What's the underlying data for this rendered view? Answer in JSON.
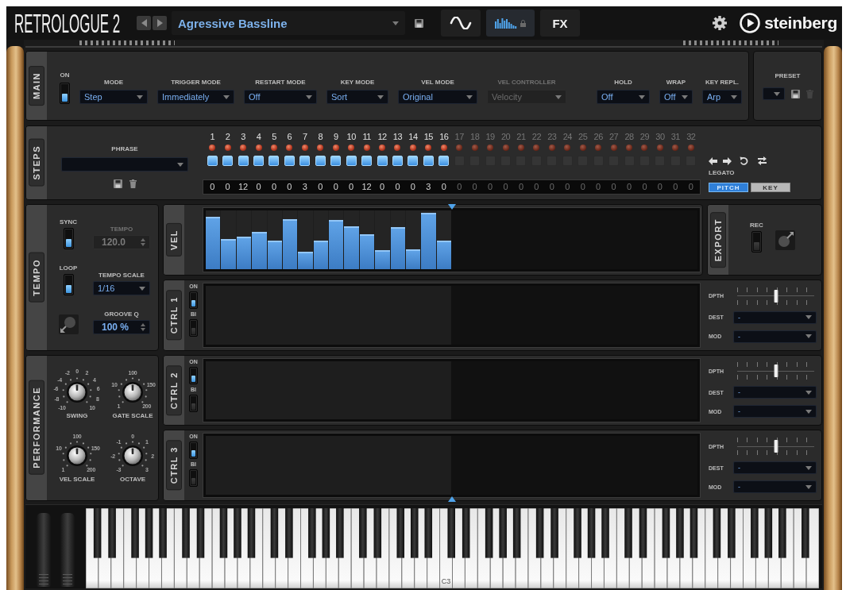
{
  "header": {
    "product": "RETROLOGUE 2",
    "preset_name": "Agressive Bassline",
    "pages": [
      {
        "kind": "wave",
        "selected": false
      },
      {
        "kind": "sequencer",
        "selected": true
      },
      {
        "kind": "label",
        "label": "FX",
        "selected": false
      }
    ],
    "brand": "steinberg"
  },
  "main": {
    "tab": "MAIN",
    "on_label": "ON",
    "on": true,
    "dropdowns": [
      {
        "label": "MODE",
        "value": "Step",
        "disabled": false
      },
      {
        "label": "TRIGGER MODE",
        "value": "Immediately",
        "disabled": false
      },
      {
        "label": "RESTART MODE",
        "value": "Off",
        "disabled": false
      },
      {
        "label": "KEY MODE",
        "value": "Sort",
        "disabled": false
      },
      {
        "label": "VEL MODE",
        "value": "Original",
        "disabled": false
      },
      {
        "label": "VEL CONTROLLER",
        "value": "Velocity",
        "disabled": true
      },
      {
        "label": "HOLD",
        "value": "Off",
        "disabled": false
      },
      {
        "label": "WRAP",
        "value": "Off",
        "disabled": false
      },
      {
        "label": "KEY REPL.",
        "value": "Arp",
        "disabled": false
      }
    ]
  },
  "preset": {
    "label": "PRESET",
    "actions": [
      {
        "kind": "save",
        "disabled": false
      },
      {
        "kind": "delete",
        "disabled": true
      }
    ]
  },
  "steps": {
    "tab": "STEPS",
    "phrase_label": "PHRASE",
    "items": [
      {
        "number": "1",
        "value": "0",
        "enabled": true
      },
      {
        "number": "2",
        "value": "0",
        "enabled": true
      },
      {
        "number": "3",
        "value": "12",
        "enabled": true
      },
      {
        "number": "4",
        "value": "0",
        "enabled": true
      },
      {
        "number": "5",
        "value": "0",
        "enabled": true
      },
      {
        "number": "6",
        "value": "0",
        "enabled": true
      },
      {
        "number": "7",
        "value": "3",
        "enabled": true
      },
      {
        "number": "8",
        "value": "0",
        "enabled": true
      },
      {
        "number": "9",
        "value": "0",
        "enabled": true
      },
      {
        "number": "10",
        "value": "0",
        "enabled": true
      },
      {
        "number": "11",
        "value": "12",
        "enabled": true
      },
      {
        "number": "12",
        "value": "0",
        "enabled": true
      },
      {
        "number": "13",
        "value": "0",
        "enabled": true
      },
      {
        "number": "14",
        "value": "0",
        "enabled": true
      },
      {
        "number": "15",
        "value": "3",
        "enabled": true
      },
      {
        "number": "16",
        "value": "0",
        "enabled": true
      },
      {
        "number": "17",
        "value": "0",
        "enabled": false
      },
      {
        "number": "18",
        "value": "0",
        "enabled": false
      },
      {
        "number": "19",
        "value": "0",
        "enabled": false
      },
      {
        "number": "20",
        "value": "0",
        "enabled": false
      },
      {
        "number": "21",
        "value": "0",
        "enabled": false
      },
      {
        "number": "22",
        "value": "0",
        "enabled": false
      },
      {
        "number": "23",
        "value": "0",
        "enabled": false
      },
      {
        "number": "24",
        "value": "0",
        "enabled": false
      },
      {
        "number": "25",
        "value": "0",
        "enabled": false
      },
      {
        "number": "26",
        "value": "0",
        "enabled": false
      },
      {
        "number": "27",
        "value": "0",
        "enabled": false
      },
      {
        "number": "28",
        "value": "0",
        "enabled": false
      },
      {
        "number": "29",
        "value": "0",
        "enabled": false
      },
      {
        "number": "30",
        "value": "0",
        "enabled": false
      },
      {
        "number": "31",
        "value": "0",
        "enabled": false
      },
      {
        "number": "32",
        "value": "0",
        "enabled": false
      }
    ],
    "legato_label": "LEGATO",
    "modes": [
      {
        "label": "PITCH",
        "selected": true
      },
      {
        "label": "KEY",
        "selected": false
      }
    ]
  },
  "tempo": {
    "tab": "TEMPO",
    "sync": {
      "label": "SYNC",
      "on": true
    },
    "tempo": {
      "label": "TEMPO",
      "value": "120.0",
      "disabled": true
    },
    "loop": {
      "label": "LOOP",
      "on": true
    },
    "tempo_scale": {
      "label": "TEMPO SCALE",
      "value": "1/16"
    },
    "groove": {
      "label": "GROOVE Q",
      "value": "100 %"
    }
  },
  "performance": {
    "tab": "PERFORMANCE",
    "knobs": [
      {
        "label": "SWING",
        "level": 0.5,
        "scale": [
          "-10",
          "-8",
          "-6",
          "-4",
          "-2",
          "0",
          "2",
          "4",
          "6",
          "8",
          "10"
        ]
      },
      {
        "label": "GATE SCALE",
        "level": 0.5,
        "scale": [
          "1",
          "10",
          "100",
          "150",
          "200"
        ]
      },
      {
        "label": "VEL SCALE",
        "level": 0.5,
        "scale": [
          "1",
          "10",
          "100",
          "150",
          "200"
        ]
      },
      {
        "label": "OCTAVE",
        "level": 0.5,
        "scale": [
          "-3",
          "-2",
          "-1",
          "0",
          "1",
          "2",
          "3"
        ]
      }
    ]
  },
  "velocity_lane": {
    "tab": "VEL",
    "bars": [
      {
        "level": 0.89
      },
      {
        "level": 0.51
      },
      {
        "level": 0.55
      },
      {
        "level": 0.64
      },
      {
        "level": 0.48
      },
      {
        "level": 0.85
      },
      {
        "level": 0.3
      },
      {
        "level": 0.48
      },
      {
        "level": 0.84
      },
      {
        "level": 0.73
      },
      {
        "level": 0.59
      },
      {
        "level": 0.32
      },
      {
        "level": 0.71
      },
      {
        "level": 0.34
      },
      {
        "level": 0.96
      },
      {
        "level": 0.48
      }
    ]
  },
  "export": {
    "tab": "EXPORT",
    "rec_label": "REC",
    "rec": false
  },
  "ctrl_lanes": [
    {
      "tab": "CTRL 1",
      "on_label": "ON",
      "on": true,
      "bi_label": "BI",
      "bi": false,
      "depth": {
        "label": "DPTH",
        "level": 0.5
      },
      "dest": {
        "label": "DEST",
        "value": "-"
      },
      "mod": {
        "label": "MOD",
        "value": "-"
      }
    },
    {
      "tab": "CTRL 2",
      "on_label": "ON",
      "on": true,
      "bi_label": "BI",
      "bi": false,
      "depth": {
        "label": "DPTH",
        "level": 0.5
      },
      "dest": {
        "label": "DEST",
        "value": "-"
      },
      "mod": {
        "label": "MOD",
        "value": "-"
      }
    },
    {
      "tab": "CTRL 3",
      "on_label": "ON",
      "on": true,
      "bi_label": "BI",
      "bi": false,
      "depth": {
        "label": "DPTH",
        "level": 0.5
      },
      "dest": {
        "label": "DEST",
        "value": "-"
      },
      "mod": {
        "label": "MOD",
        "value": "-"
      }
    }
  ],
  "keyboard": {
    "label": "C3"
  }
}
